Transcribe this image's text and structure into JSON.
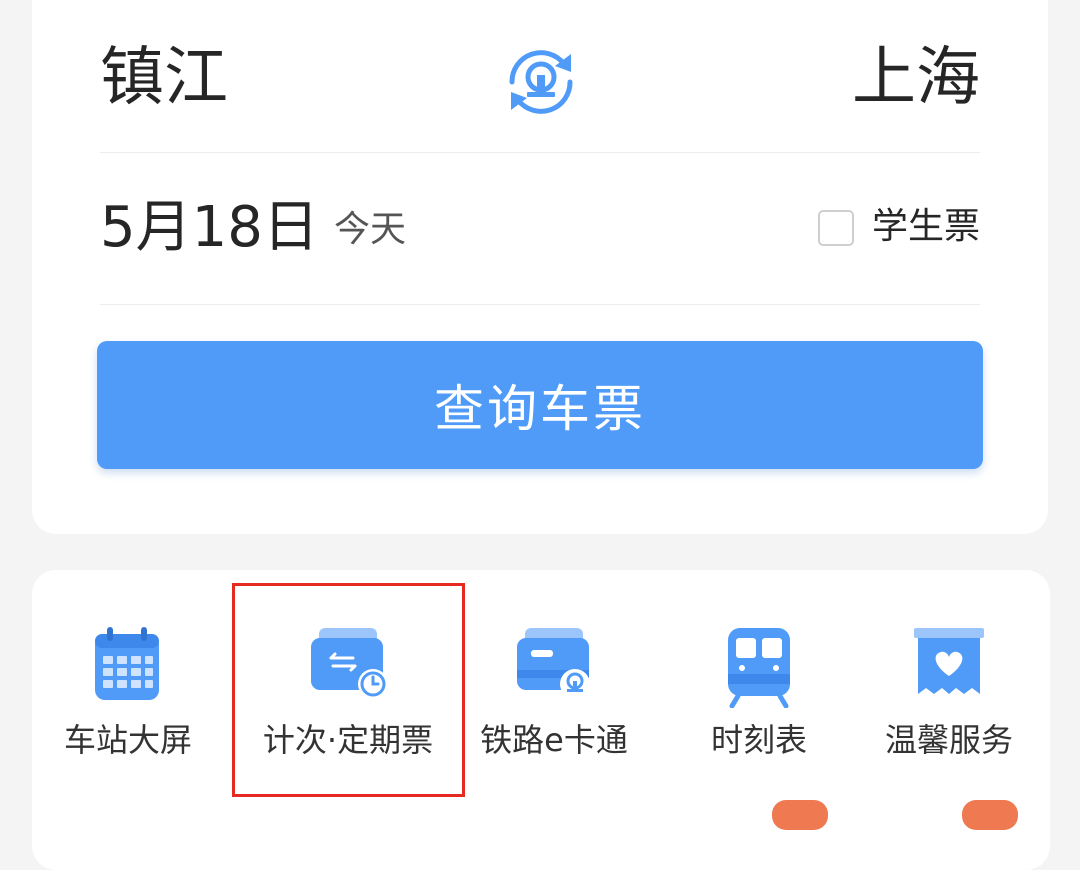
{
  "route": {
    "from_station": "镇江",
    "to_station": "上海"
  },
  "date": {
    "value": "5月18日",
    "relative": "今天"
  },
  "student_ticket": {
    "label": "学生票",
    "checked": false
  },
  "search_button": {
    "label": "查询车票"
  },
  "services": [
    {
      "label": "车站大屏",
      "icon": "calendar-icon"
    },
    {
      "label": "计次·定期票",
      "icon": "pass-card-icon"
    },
    {
      "label": "铁路e卡通",
      "icon": "e-card-icon"
    },
    {
      "label": "时刻表",
      "icon": "train-icon"
    },
    {
      "label": "温馨服务",
      "icon": "heart-service-icon"
    }
  ],
  "colors": {
    "accent": "#4f9bf7",
    "highlight": "#e62a22",
    "text": "#262626"
  }
}
